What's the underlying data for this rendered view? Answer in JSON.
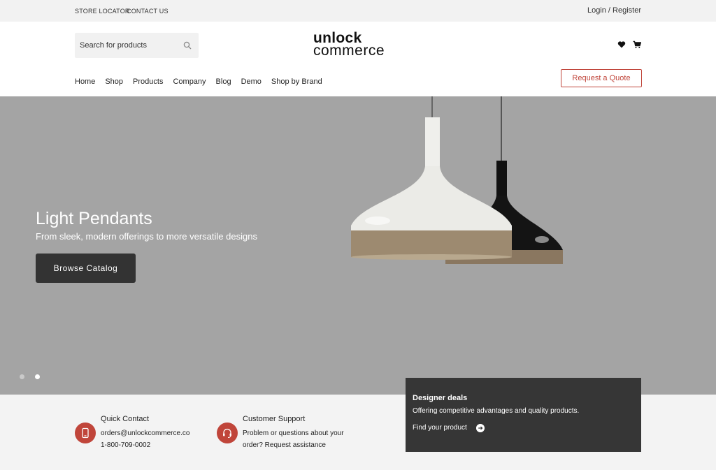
{
  "topbar": {
    "store_locator": "STORE LOCATOR",
    "contact_us": "CONTACT US",
    "login": "Login / Register"
  },
  "header": {
    "search_placeholder": "Search for products",
    "logo_line1": "unlock",
    "logo_line2": "commerce",
    "quote_button": "Request a Quote"
  },
  "nav": {
    "items": [
      "Home",
      "Shop",
      "Products",
      "Company",
      "Blog",
      "Demo",
      "Shop by Brand"
    ]
  },
  "hero": {
    "title": "Light Pendants",
    "subtitle": "From sleek, modern offerings to more versatile designs",
    "button": "Browse Catalog",
    "active_slide": 2,
    "slide_count": 2
  },
  "quick_contact": {
    "title": "Quick Contact",
    "email": "orders@unlockcommerce.co",
    "phone": "1-800-709-0002"
  },
  "support": {
    "title": "Customer Support",
    "line1": "Problem or questions about your",
    "line2": "order? Request assistance"
  },
  "deals": {
    "title": "Designer deals",
    "description": "Offering competitive advantages and quality products.",
    "link": "Find your product"
  },
  "colors": {
    "accent": "#c0453a",
    "hero_bg": "#a4a4a4",
    "dark": "#363636"
  }
}
